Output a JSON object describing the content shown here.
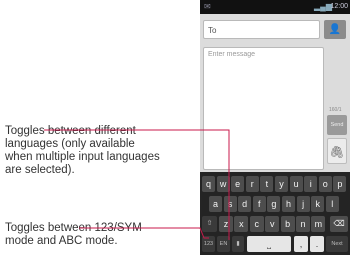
{
  "callouts": {
    "languages": "Toggles between different languages (only available when multiple input languages are selected).",
    "symbol_mode": "Toggles between 123/SYM mode and ABC mode."
  },
  "status_bar": {
    "time": "12:00"
  },
  "compose": {
    "to_placeholder": "To",
    "message_placeholder": "Enter message",
    "send_label": "Send",
    "char_count": "160/1"
  },
  "keyboard": {
    "row1": [
      "q",
      "w",
      "e",
      "r",
      "t",
      "y",
      "u",
      "i",
      "o",
      "p"
    ],
    "row2": [
      "a",
      "s",
      "d",
      "f",
      "g",
      "h",
      "j",
      "k",
      "l"
    ],
    "row3": [
      "z",
      "x",
      "c",
      "v",
      "b",
      "n",
      "m"
    ],
    "shift_label": "⇧",
    "delete_label": "⌫",
    "symbol_mode_label": "123",
    "language_label": "EN",
    "mic_label": "🎤",
    "comma_label": ",",
    "period_label": ".",
    "next_label": "Next"
  },
  "colors": {
    "callout_line": "#c8194b"
  }
}
